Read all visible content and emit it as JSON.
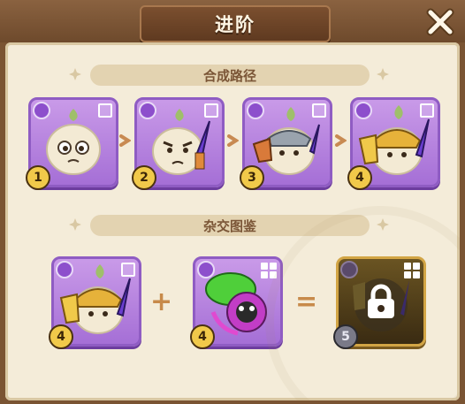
{
  "window": {
    "title": "进阶"
  },
  "sections": {
    "path": {
      "title": "合成路径"
    },
    "hybrid": {
      "title": "杂交图鉴"
    }
  },
  "path_cards": [
    {
      "level": "1",
      "name": "garlic-level-1"
    },
    {
      "level": "2",
      "name": "garlic-level-2"
    },
    {
      "level": "3",
      "name": "garlic-level-3"
    },
    {
      "level": "4",
      "name": "garlic-level-4"
    }
  ],
  "hybrid": {
    "left": {
      "level": "4"
    },
    "right": {
      "level": "4"
    },
    "result": {
      "level": "5",
      "locked": true
    },
    "plus": "+",
    "equals": "="
  },
  "colors": {
    "purple_card": "#b47fe0",
    "gold_card": "#d2a545",
    "panel_bg": "#f4ecd9",
    "header_bg": "#e3d3b1",
    "accent_brown": "#7b5637"
  },
  "icons": [
    "close-icon",
    "lock-icon",
    "chevron-right-icon",
    "sparkle-icon"
  ]
}
